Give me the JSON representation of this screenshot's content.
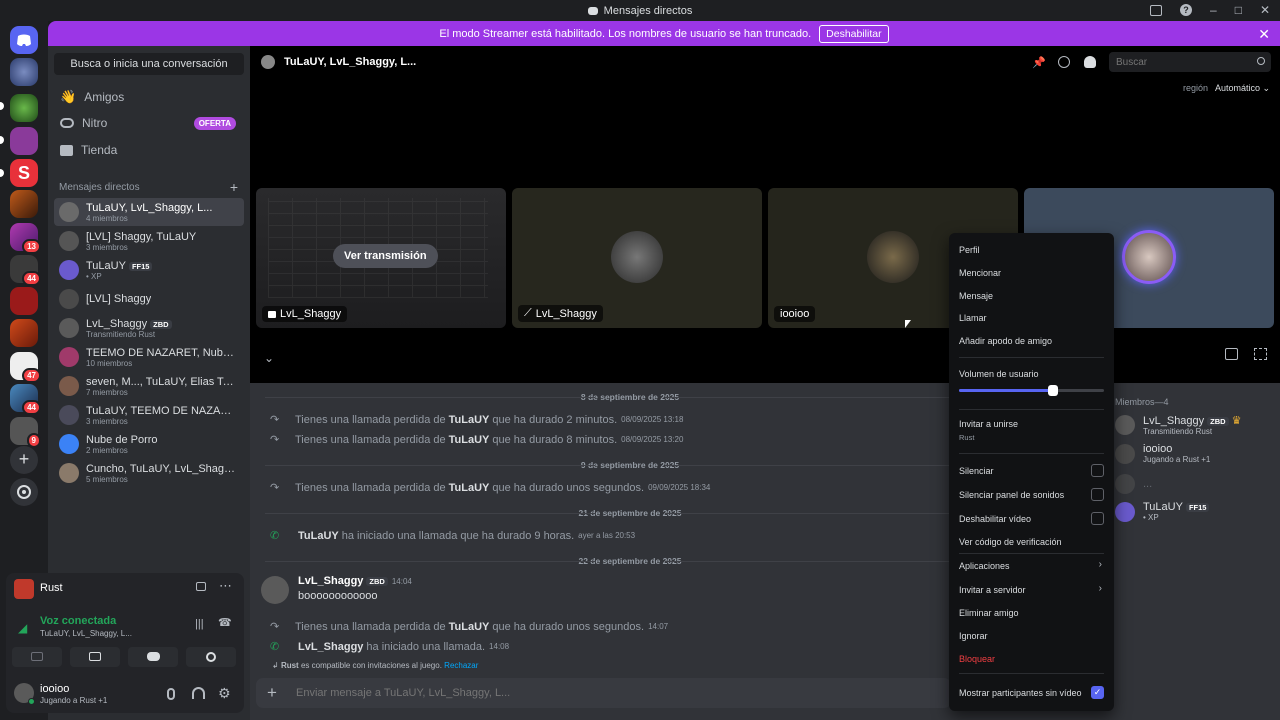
{
  "window": {
    "title": "Mensajes directos"
  },
  "banner": {
    "text": "El modo Streamer está habilitado. Los nombres de usuario se han truncado.",
    "button": "Deshabilitar"
  },
  "sidebar": {
    "search": "Busca o inicia una conversación",
    "nav": [
      "Amigos",
      "Nitro",
      "Tienda"
    ],
    "nitro_badge": "OFERTA",
    "section": "Mensajes directos",
    "dms": [
      {
        "name": "TuLaUY, LvL_Shaggy, L...",
        "sub": "4 miembros"
      },
      {
        "name": "[LVL] Shaggy, TuLaUY",
        "sub": "3 miembros"
      },
      {
        "name": "TuLaUY",
        "tag": "FF15",
        "sub": "• XP"
      },
      {
        "name": "[LVL] Shaggy",
        "sub": ""
      },
      {
        "name": "LvL_Shaggy",
        "tag": "ZBD",
        "sub": "Transmitiendo Rust"
      },
      {
        "name": "TEEMO DE NAZARET, Nube d...",
        "sub": "10 miembros"
      },
      {
        "name": "seven, M..., TuLaUY, Elias Tom...",
        "sub": "7 miembros"
      },
      {
        "name": "TuLaUY, TEEMO DE NAZARET",
        "sub": "3 miembros"
      },
      {
        "name": "Nube de Porro",
        "sub": "2 miembros"
      },
      {
        "name": "Cuncho, TuLaUY, LvL_Shaggy,...",
        "sub": "5 miembros"
      }
    ]
  },
  "server_badges": [
    "13",
    "44",
    "47",
    "44",
    "9"
  ],
  "voice": {
    "activity": "Rust",
    "status": "Voz conectada",
    "channel": "TuLaUY, LvL_Shaggy, L..."
  },
  "user": {
    "name": "iooioo",
    "status": "Jugando a Rust +1"
  },
  "header": {
    "title": "TuLaUY, LvL_Shaggy, L...",
    "search_placeholder": "Buscar",
    "region_label": "región",
    "region_value": "Automático"
  },
  "tiles": [
    {
      "label": "LvL_Shaggy",
      "overlay": "Ver transmisión"
    },
    {
      "label": "LvL_Shaggy"
    },
    {
      "label": "iooioo"
    },
    {
      "label": ""
    }
  ],
  "messages": {
    "sep1": "8 de septiembre de 2025",
    "m1": {
      "pre": "Tienes una llamada perdida de",
      "user": "TuLaUY",
      "post": "que ha durado 2 minutos.",
      "time": "08/09/2025 13:18"
    },
    "m2": {
      "pre": "Tienes una llamada perdida de",
      "user": "TuLaUY",
      "post": "que ha durado 8 minutos.",
      "time": "08/09/2025 13:20"
    },
    "sep2": "9 de septiembre de 2025",
    "m3": {
      "pre": "Tienes una llamada perdida de",
      "user": "TuLaUY",
      "post": "que ha durado unos segundos.",
      "time": "09/09/2025 18:34"
    },
    "sep3": "21 de septiembre de 2025",
    "m4": {
      "user": "TuLaUY",
      "post": "ha iniciado una llamada que ha durado 9 horas.",
      "time": "ayer a las 20:53"
    },
    "sep4": "22 de septiembre de 2025",
    "m5": {
      "user": "LvL_Shaggy",
      "tag": "ZBD",
      "time": "14:04",
      "text": "boooooooooooo"
    },
    "m6": {
      "pre": "Tienes una llamada perdida de",
      "user": "TuLaUY",
      "post": "que ha durado unos segundos.",
      "time": "14:07"
    },
    "m7": {
      "user": "LvL_Shaggy",
      "post": "ha iniciado una llamada.",
      "time": "14:08"
    },
    "invite": {
      "game": "Rust",
      "text": "es compatible con invitaciones al juego.",
      "link": "Rechazar"
    }
  },
  "composer": {
    "placeholder": "Enviar mensaje a TuLaUY, LvL_Shaggy, L..."
  },
  "members": {
    "header": "Miembros—4",
    "list": [
      {
        "name": "LvL_Shaggy",
        "tag": "ZBD",
        "sub": "Transmitiendo Rust"
      },
      {
        "name": "iooioo",
        "sub": "Jugando a Rust +1"
      },
      {
        "name": "...",
        "sub": ""
      },
      {
        "name": "TuLaUY",
        "tag": "FF15",
        "sub": "• XP"
      }
    ]
  },
  "menu": {
    "perfil": "Perfil",
    "mencionar": "Mencionar",
    "mensaje": "Mensaje",
    "llamar": "Llamar",
    "apodo": "Añadir apodo de amigo",
    "volumen": "Volumen de usuario",
    "volume_level": 0.65,
    "invitar": "Invitar a unirse",
    "invitar_sub": "Rust",
    "silenciar": "Silenciar",
    "silenciar_sonidos": "Silenciar panel de sonidos",
    "deshabilitar_video": "Deshabilitar vídeo",
    "verificacion": "Ver código de verificación",
    "aplicaciones": "Aplicaciones",
    "invitar_servidor": "Invitar a servidor",
    "eliminar": "Eliminar amigo",
    "ignorar": "Ignorar",
    "bloquear": "Bloquear",
    "sin_video": "Mostrar participantes sin vídeo"
  },
  "colors": {
    "accent": "#5865f2",
    "danger": "#da373c",
    "banner": "#9b36e6",
    "online": "#23a55a"
  }
}
